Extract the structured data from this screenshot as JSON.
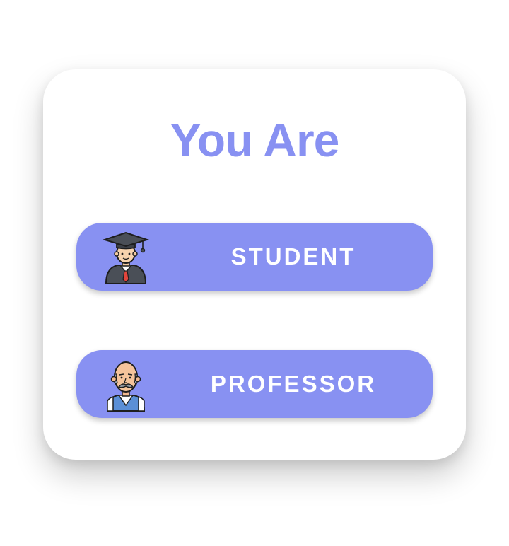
{
  "dialog": {
    "title": "You Are",
    "buttons": [
      {
        "label": "STUDENT",
        "icon": "graduate-student-icon"
      },
      {
        "label": "PROFESSOR",
        "icon": "professor-icon"
      }
    ]
  },
  "colors": {
    "accent": "#8891f2",
    "button_text": "#ffffff",
    "card_background": "#ffffff"
  }
}
